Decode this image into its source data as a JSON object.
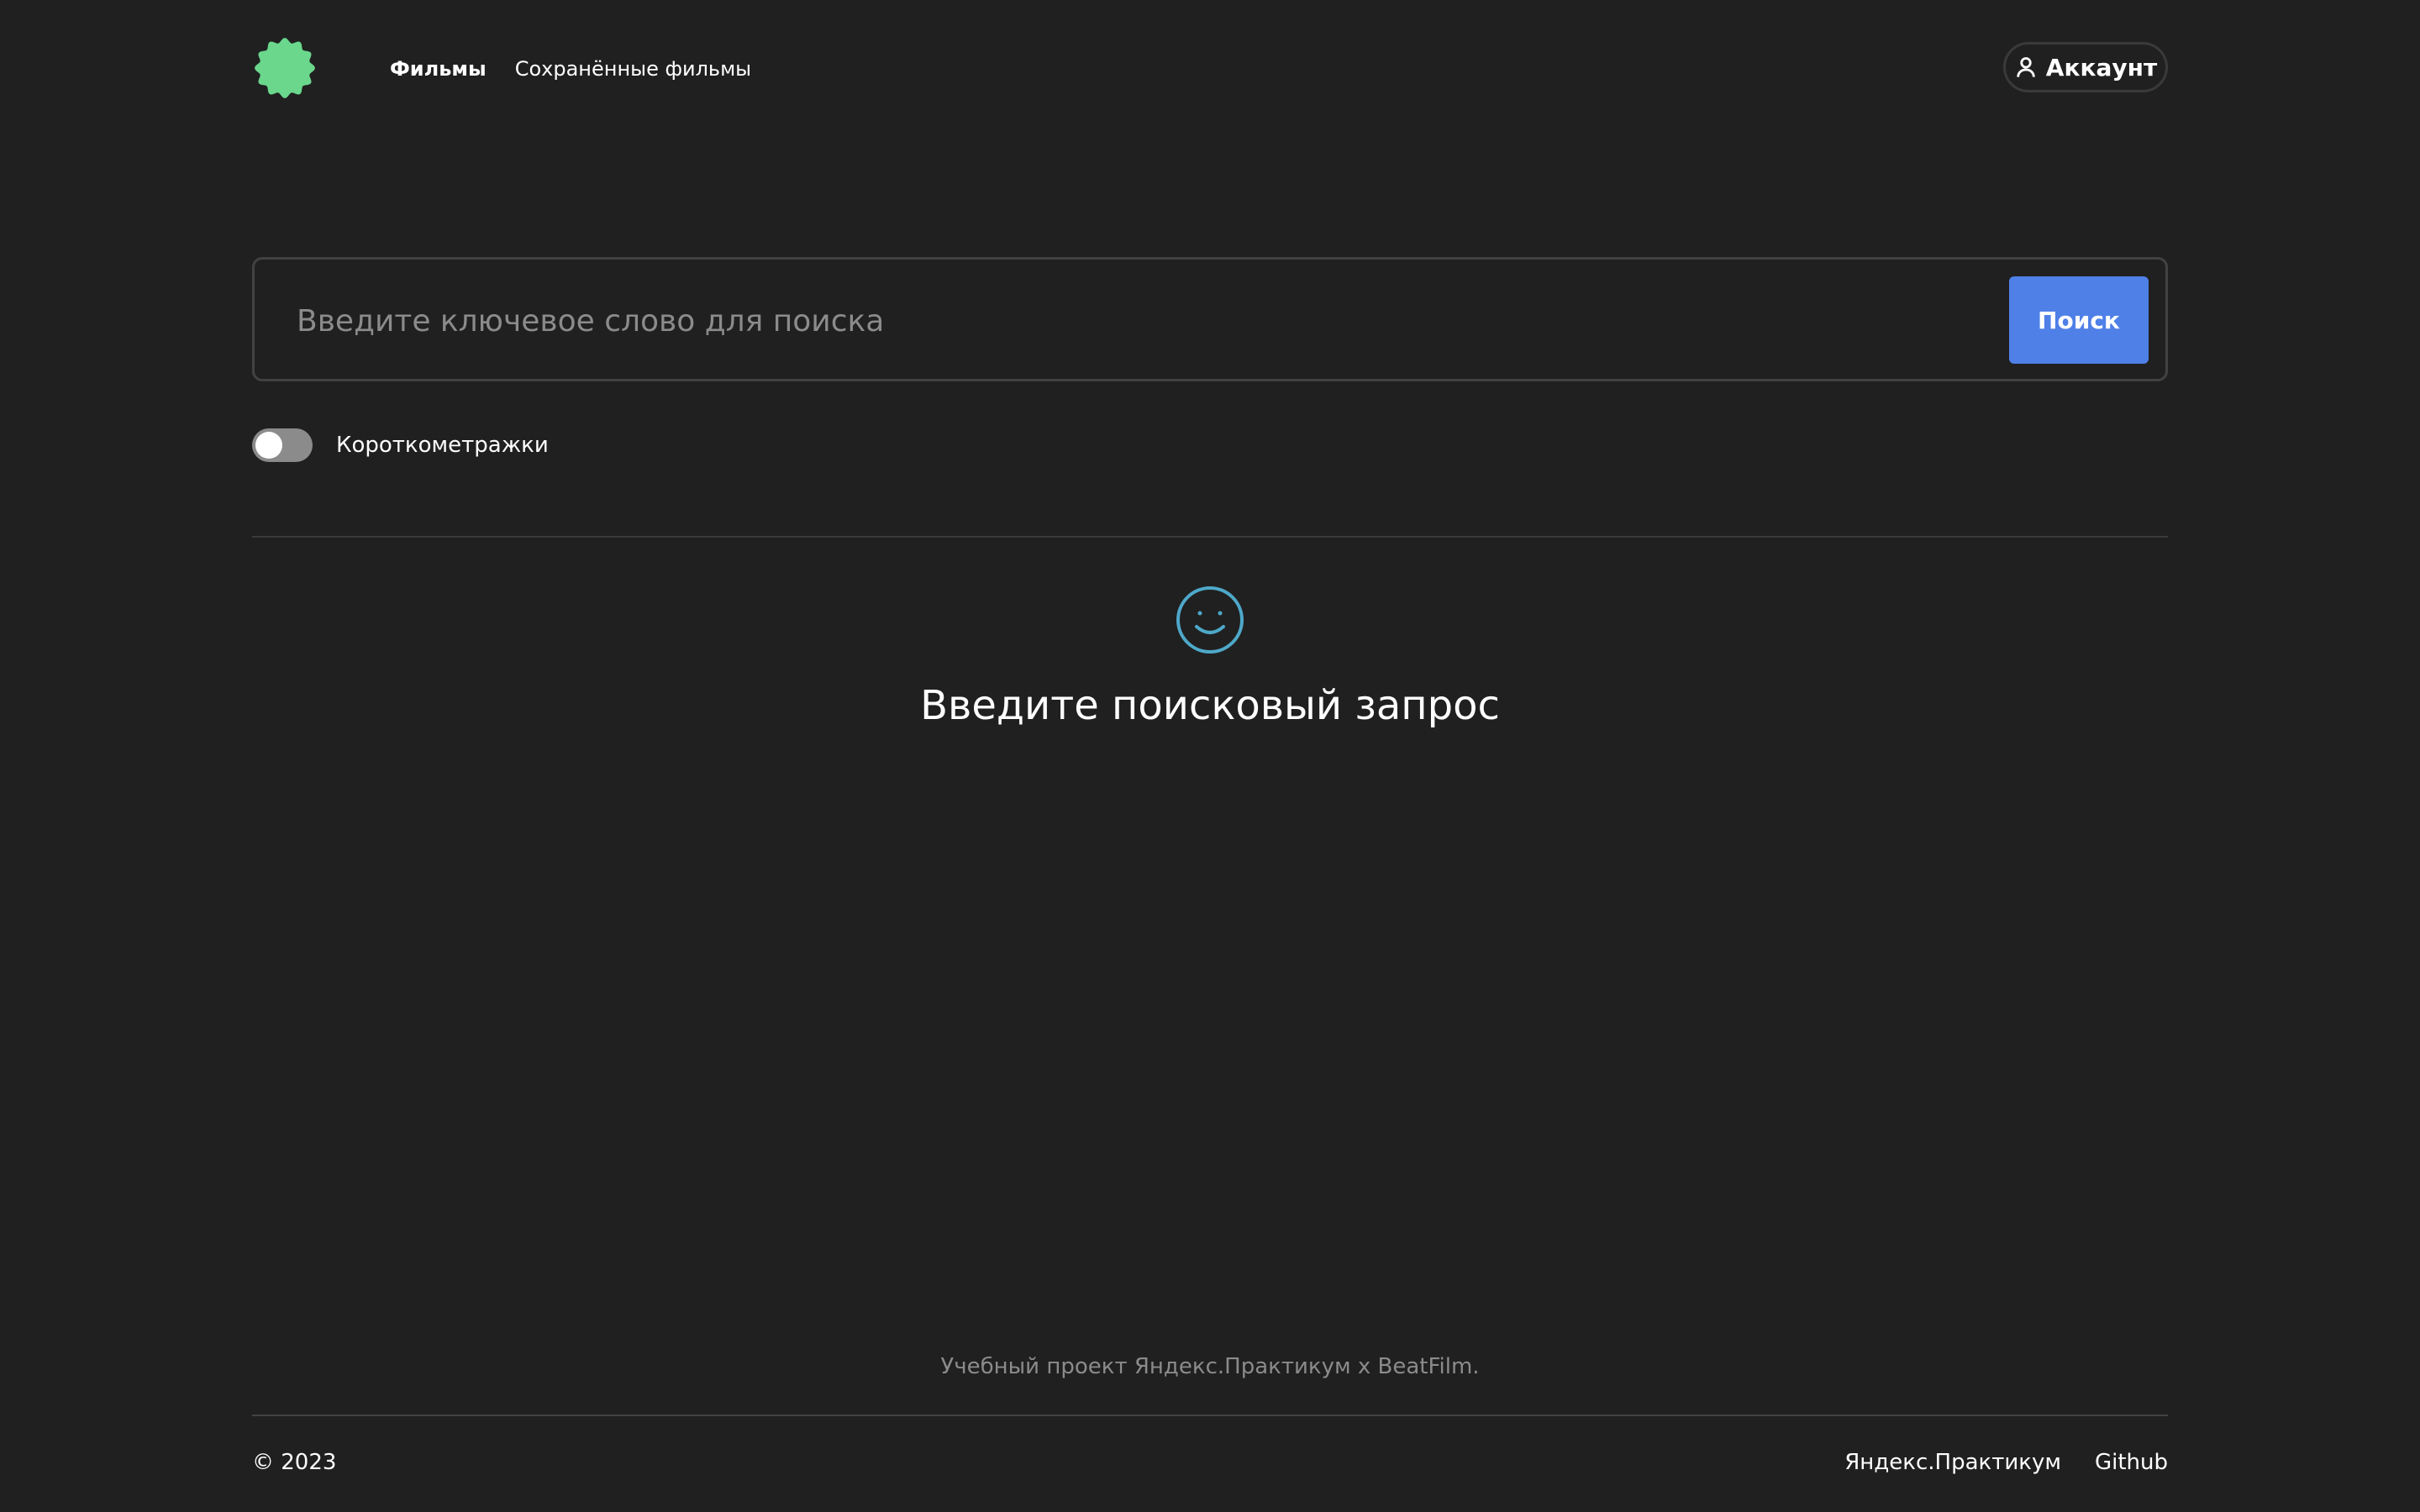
{
  "header": {
    "logo_icon": "logo-badge-icon",
    "logo_color": "#6ad78c",
    "nav": {
      "films_label": "Фильмы",
      "saved_label": "Сохранённые фильмы"
    },
    "account": {
      "icon": "user-icon",
      "label": "Аккаунт"
    }
  },
  "search": {
    "placeholder": "Введите ключевое слово для поиска",
    "value": "",
    "button_label": "Поиск",
    "button_color": "#4f80e8"
  },
  "filter": {
    "label": "Короткометражки",
    "short_films_enabled": false
  },
  "empty_state": {
    "icon": "smile-icon",
    "icon_color": "#4ea8c9",
    "title": "Введите поисковый запрос"
  },
  "footer": {
    "caption": "Учебный проект Яндекс.Практикум х BeatFilm.",
    "copyright": "© 2023",
    "links": {
      "practicum_label": "Яндекс.Практикум",
      "github_label": "Github"
    }
  }
}
